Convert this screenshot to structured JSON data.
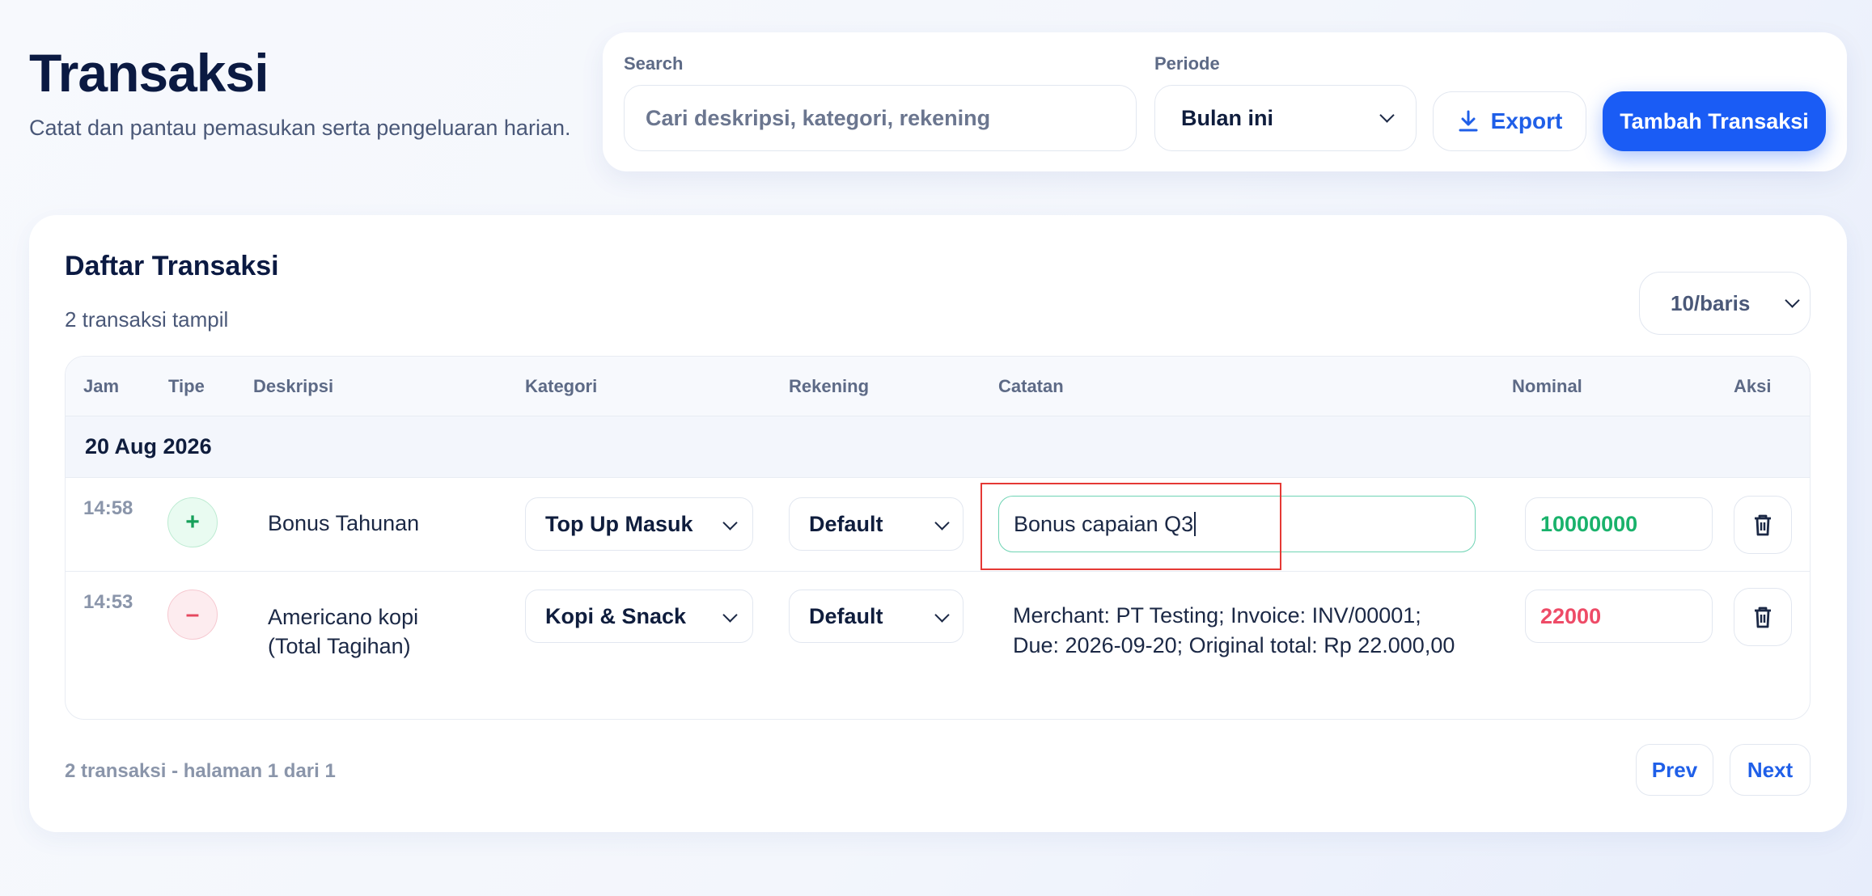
{
  "header": {
    "title": "Transaksi",
    "subtitle": "Catat dan pantau pemasukan serta pengeluaran harian."
  },
  "toolbar": {
    "search_label": "Search",
    "search_placeholder": "Cari deskripsi, kategori, rekening",
    "periode_label": "Periode",
    "periode_value": "Bulan ini",
    "export_label": "Export",
    "add_label": "Tambah Transaksi"
  },
  "list": {
    "title": "Daftar Transaksi",
    "count_text": "2 transaksi tampil",
    "rows_per_page": "10/baris",
    "columns": [
      "Jam",
      "Tipe",
      "Deskripsi",
      "Kategori",
      "Rekening",
      "Catatan",
      "Nominal",
      "Aksi"
    ],
    "group_date": "20 Aug 2026",
    "rows": [
      {
        "time": "14:58",
        "type": "+",
        "description": "Bonus Tahunan",
        "category": "Top Up Masuk",
        "account": "Default",
        "note": "Bonus capaian Q3",
        "amount": "10000000"
      },
      {
        "time": "14:53",
        "type": "–",
        "description": "Americano kopi (Total Tagihan)",
        "category": "Kopi & Snack",
        "account": "Default",
        "note": "Merchant: PT Testing; Invoice: INV/00001; Due: 2026-09-20; Original total: Rp 22.000,00",
        "amount": "22000"
      }
    ]
  },
  "footer": {
    "info": "2 transaksi - halaman 1 dari 1",
    "prev_label": "Prev",
    "next_label": "Next"
  },
  "colors": {
    "primary": "#1a5cf5",
    "income": "#19b26b",
    "expense": "#ee4b67",
    "highlight": "#e53935"
  },
  "icons": {
    "export": "download-icon",
    "delete": "trash-icon",
    "dropdown": "chevron-down-icon"
  }
}
